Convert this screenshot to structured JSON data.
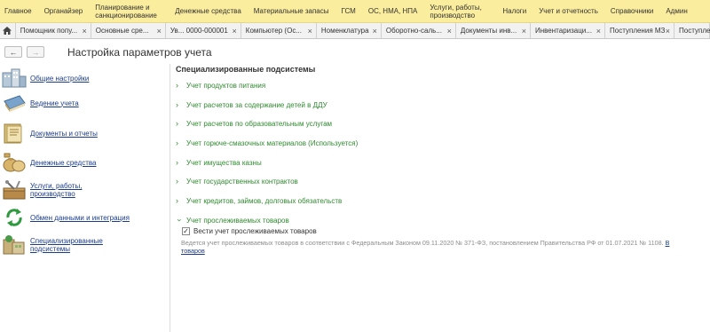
{
  "top_menu": [
    "Главное",
    "Органайзер",
    "Планирование и\nсанкционирование",
    "Денежные средства",
    "Материальные запасы",
    "ГСМ",
    "ОС, НМА, НПА",
    "Услуги, работы,\nпроизводство",
    "Налоги",
    "Учет и отчетность",
    "Справочники",
    "Админ"
  ],
  "tabs": [
    "Помощник попу...",
    "Основные сре...",
    "Ув... 0000-000001",
    "Компьютер (Ос...",
    "Номенклатура",
    "Оборотно-саль...",
    "Документы инв...",
    "Инвентаризаци...",
    "Поступления МЗ",
    "Поступле"
  ],
  "header": {
    "back": "←",
    "forward": "→",
    "title": "Настройка параметров учета"
  },
  "sidebar": {
    "items": [
      {
        "label": "Общие настройки"
      },
      {
        "label": "Ведение учета"
      },
      {
        "label": "Документы и отчеты"
      },
      {
        "label": "Денежные средства"
      },
      {
        "label": "Услуги, работы,\nпроизводство"
      },
      {
        "label": "Обмен данными и интеграция"
      },
      {
        "label": "Специализированные\nподсистемы"
      }
    ]
  },
  "main": {
    "section_title": "Специализированные подсистемы",
    "groups": [
      "Учет продуктов питания",
      "Учет расчетов за содержание детей в ДДУ",
      "Учет расчетов по образовательным услугам",
      "Учет горюче-смазочных материалов (Используется)",
      "Учет имущества казны",
      "Учет государственных контрактов",
      "Учет кредитов, займов, долговых обязательств"
    ],
    "tracked_group": "Учет прослеживаемых товаров",
    "tracked_checkbox": {
      "label": "Вести учет прослеживаемых товаров",
      "checked": true
    },
    "description": "Ведется учет прослеживаемых товаров в соответствии с Федеральным Законом 09.11.2020 № 371-ФЗ, постановлением Правительства РФ от 01.07.2021 № 1108. ",
    "description_link_start": "В",
    "description_link_end": "товаров"
  },
  "colors": {
    "menu_bg": "#fbed9e",
    "link": "#1a3c8a",
    "group": "#2e8a2e"
  }
}
